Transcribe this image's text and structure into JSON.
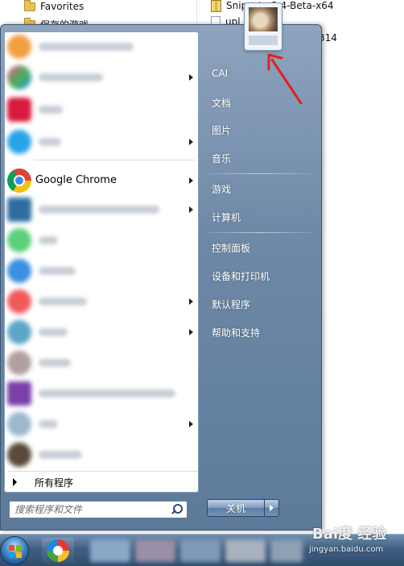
{
  "explorer": {
    "favorites_label": "Favorites",
    "saved_games_label": "保存的游戏",
    "file_1": "Snipaste-2.4-Beta-x64",
    "file_2": "upl",
    "file_3_suffix": "314"
  },
  "start_menu": {
    "pinned_program": "Google Chrome",
    "all_programs_label": "所有程序",
    "search_placeholder": "搜索程序和文件",
    "right_items": [
      {
        "label": "CAI"
      },
      {
        "label": "文档"
      },
      {
        "label": "图片"
      },
      {
        "label": "音乐"
      },
      {
        "label": "游戏"
      },
      {
        "label": "计算机"
      },
      {
        "label": "控制面板"
      },
      {
        "label": "设备和打印机"
      },
      {
        "label": "默认程序"
      },
      {
        "label": "帮助和支持"
      }
    ],
    "shutdown_label": "关机"
  },
  "watermark": {
    "main": "Bai度 经验",
    "sub": "jingyan.baidu.com"
  },
  "colors": {
    "annotation_arrow": "#e02020",
    "start_menu_bg": "#6f8aa8",
    "taskbar_bg": "#3f5f82"
  }
}
